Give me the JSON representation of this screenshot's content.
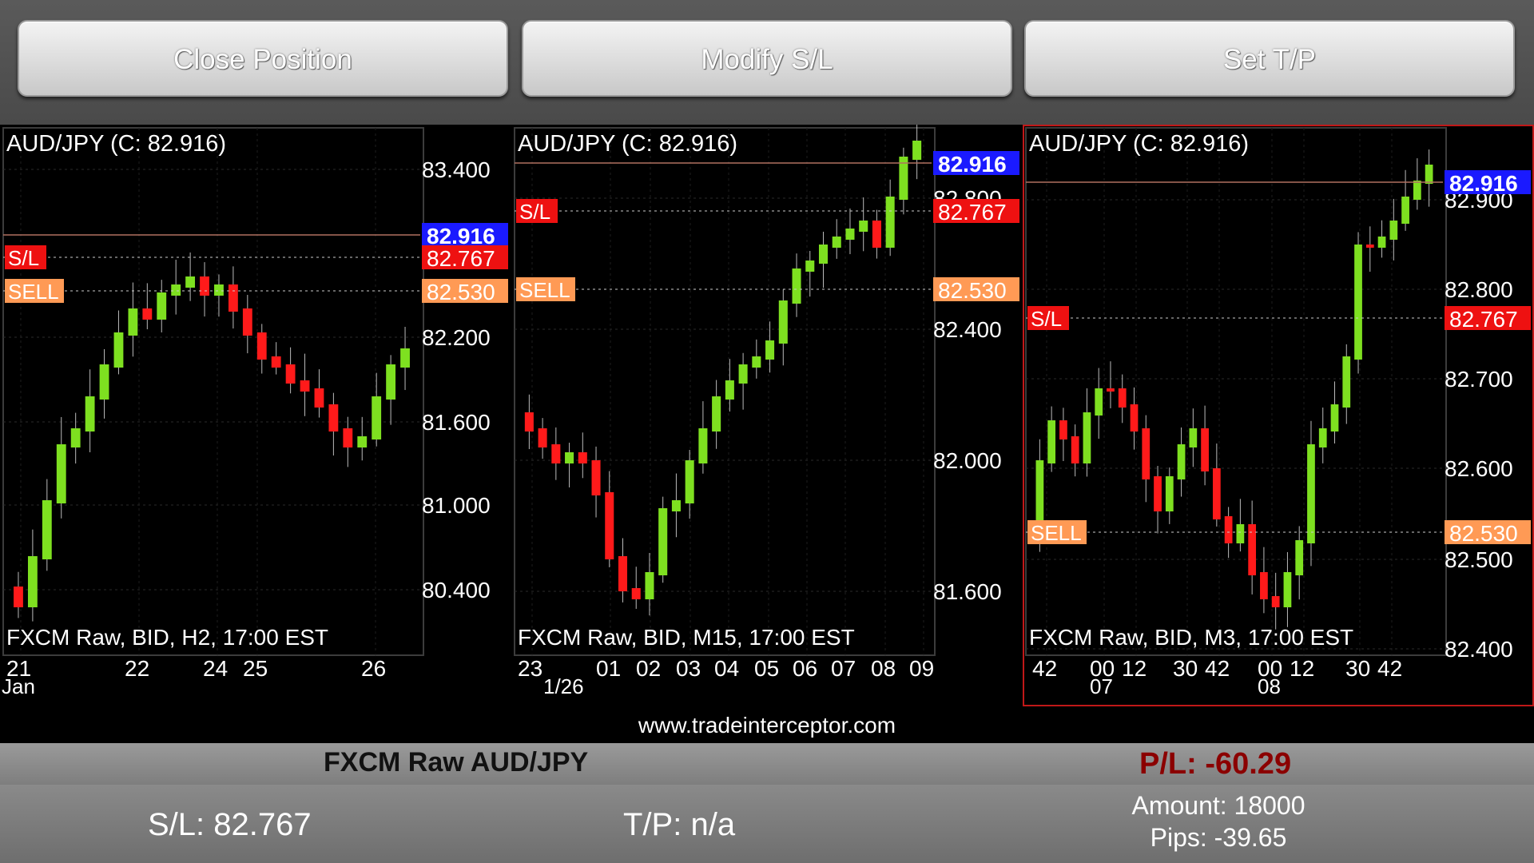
{
  "toolbar": {
    "close_position": "Close Position",
    "modify_sl": "Modify S/L",
    "set_tp": "Set T/P"
  },
  "charts": [
    {
      "title": "AUD/JPY (C: 82.916)",
      "footer": "FXCM Raw, BID, H2, 17:00 EST",
      "price_ticks": [
        "83.400",
        "82.200",
        "81.600",
        "81.000",
        "80.400"
      ],
      "time_ticks": [
        "21",
        "22",
        "24",
        "25",
        "26"
      ],
      "time_sub": [
        "Jan"
      ],
      "current_price": "82.916",
      "sl_price": "82.767",
      "sell_price": "82.530",
      "sl_tag": "S/L",
      "sell_tag": "SELL"
    },
    {
      "title": "AUD/JPY (C: 82.916)",
      "footer": "FXCM Raw, BID, M15, 17:00 EST",
      "price_ticks": [
        "82.800",
        "82.400",
        "82.000",
        "81.600"
      ],
      "time_ticks": [
        "23",
        "01",
        "02",
        "03",
        "04",
        "05",
        "06",
        "07",
        "08",
        "09"
      ],
      "time_sub": [
        "1/26"
      ],
      "current_price": "82.916",
      "sl_price": "82.767",
      "sell_price": "82.530",
      "sl_tag": "S/L",
      "sell_tag": "SELL"
    },
    {
      "title": "AUD/JPY (C: 82.916)",
      "footer": "FXCM Raw, BID, M3, 17:00 EST",
      "price_ticks": [
        "82.900",
        "82.800",
        "82.700",
        "82.600",
        "82.500",
        "82.400"
      ],
      "time_ticks": [
        "42",
        "00",
        "12",
        "30",
        "42",
        "00",
        "12",
        "30",
        "42"
      ],
      "time_sub": [
        "07",
        "08"
      ],
      "current_price": "82.916",
      "sl_price": "82.767",
      "sell_price": "82.530",
      "sl_tag": "S/L",
      "sell_tag": "SELL"
    }
  ],
  "website": "www.tradeinterceptor.com",
  "position": {
    "symbol": "FXCM Raw AUD/JPY",
    "pl": "P/L: -60.29",
    "sl": "S/L: 82.767",
    "tp": "T/P: n/a",
    "amount": "Amount: 18000",
    "pips": "Pips: -39.65"
  },
  "colors": {
    "bull": "#7ee020",
    "bear": "#ff1a1a",
    "current_tag": "#1a1aff",
    "sl_tag": "#ee1111",
    "sell_tag": "#ff9a55",
    "pl_text": "#8b0000"
  }
}
